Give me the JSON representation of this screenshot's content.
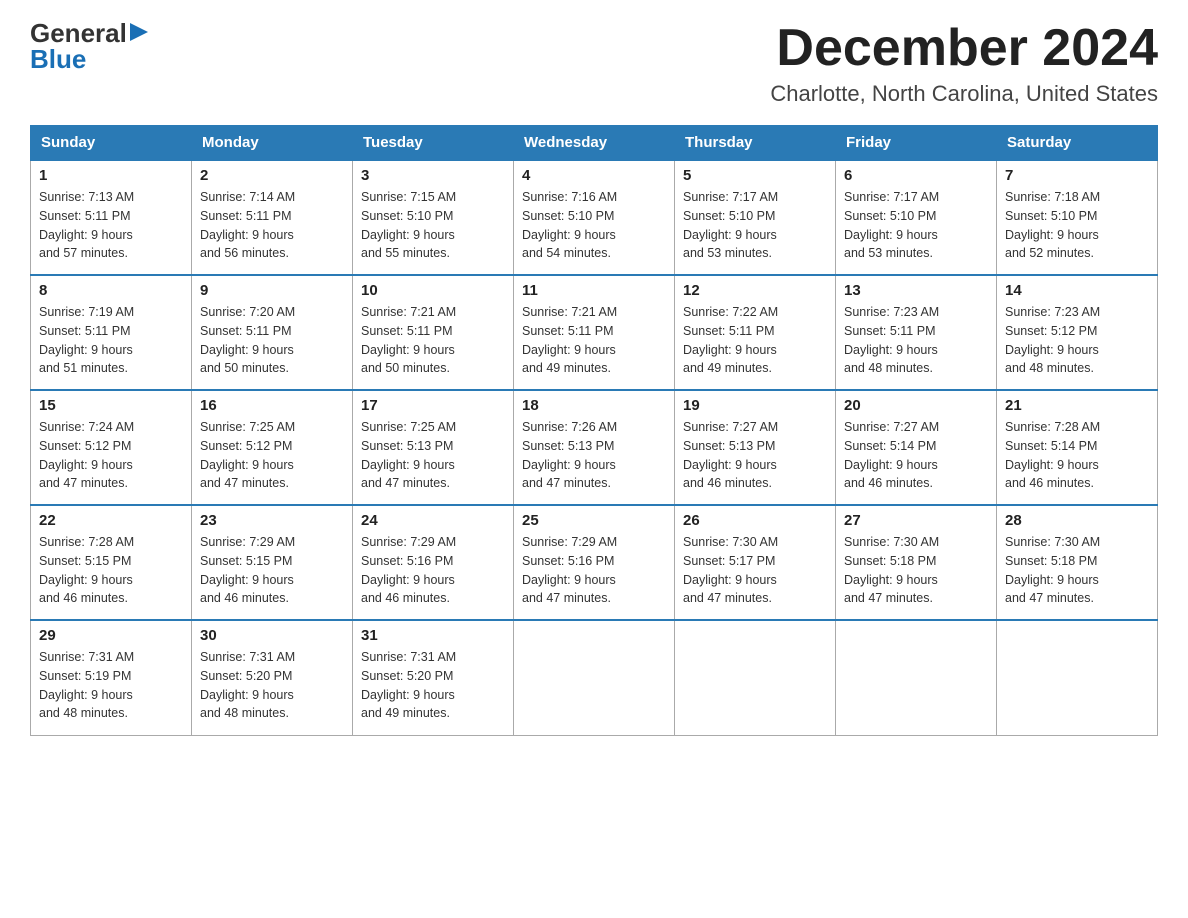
{
  "header": {
    "logo_general": "General",
    "logo_blue": "Blue",
    "month": "December 2024",
    "location": "Charlotte, North Carolina, United States"
  },
  "weekdays": [
    "Sunday",
    "Monday",
    "Tuesday",
    "Wednesday",
    "Thursday",
    "Friday",
    "Saturday"
  ],
  "weeks": [
    [
      {
        "day": "1",
        "sunrise": "7:13 AM",
        "sunset": "5:11 PM",
        "daylight": "9 hours and 57 minutes."
      },
      {
        "day": "2",
        "sunrise": "7:14 AM",
        "sunset": "5:11 PM",
        "daylight": "9 hours and 56 minutes."
      },
      {
        "day": "3",
        "sunrise": "7:15 AM",
        "sunset": "5:10 PM",
        "daylight": "9 hours and 55 minutes."
      },
      {
        "day": "4",
        "sunrise": "7:16 AM",
        "sunset": "5:10 PM",
        "daylight": "9 hours and 54 minutes."
      },
      {
        "day": "5",
        "sunrise": "7:17 AM",
        "sunset": "5:10 PM",
        "daylight": "9 hours and 53 minutes."
      },
      {
        "day": "6",
        "sunrise": "7:17 AM",
        "sunset": "5:10 PM",
        "daylight": "9 hours and 53 minutes."
      },
      {
        "day": "7",
        "sunrise": "7:18 AM",
        "sunset": "5:10 PM",
        "daylight": "9 hours and 52 minutes."
      }
    ],
    [
      {
        "day": "8",
        "sunrise": "7:19 AM",
        "sunset": "5:11 PM",
        "daylight": "9 hours and 51 minutes."
      },
      {
        "day": "9",
        "sunrise": "7:20 AM",
        "sunset": "5:11 PM",
        "daylight": "9 hours and 50 minutes."
      },
      {
        "day": "10",
        "sunrise": "7:21 AM",
        "sunset": "5:11 PM",
        "daylight": "9 hours and 50 minutes."
      },
      {
        "day": "11",
        "sunrise": "7:21 AM",
        "sunset": "5:11 PM",
        "daylight": "9 hours and 49 minutes."
      },
      {
        "day": "12",
        "sunrise": "7:22 AM",
        "sunset": "5:11 PM",
        "daylight": "9 hours and 49 minutes."
      },
      {
        "day": "13",
        "sunrise": "7:23 AM",
        "sunset": "5:11 PM",
        "daylight": "9 hours and 48 minutes."
      },
      {
        "day": "14",
        "sunrise": "7:23 AM",
        "sunset": "5:12 PM",
        "daylight": "9 hours and 48 minutes."
      }
    ],
    [
      {
        "day": "15",
        "sunrise": "7:24 AM",
        "sunset": "5:12 PM",
        "daylight": "9 hours and 47 minutes."
      },
      {
        "day": "16",
        "sunrise": "7:25 AM",
        "sunset": "5:12 PM",
        "daylight": "9 hours and 47 minutes."
      },
      {
        "day": "17",
        "sunrise": "7:25 AM",
        "sunset": "5:13 PM",
        "daylight": "9 hours and 47 minutes."
      },
      {
        "day": "18",
        "sunrise": "7:26 AM",
        "sunset": "5:13 PM",
        "daylight": "9 hours and 47 minutes."
      },
      {
        "day": "19",
        "sunrise": "7:27 AM",
        "sunset": "5:13 PM",
        "daylight": "9 hours and 46 minutes."
      },
      {
        "day": "20",
        "sunrise": "7:27 AM",
        "sunset": "5:14 PM",
        "daylight": "9 hours and 46 minutes."
      },
      {
        "day": "21",
        "sunrise": "7:28 AM",
        "sunset": "5:14 PM",
        "daylight": "9 hours and 46 minutes."
      }
    ],
    [
      {
        "day": "22",
        "sunrise": "7:28 AM",
        "sunset": "5:15 PM",
        "daylight": "9 hours and 46 minutes."
      },
      {
        "day": "23",
        "sunrise": "7:29 AM",
        "sunset": "5:15 PM",
        "daylight": "9 hours and 46 minutes."
      },
      {
        "day": "24",
        "sunrise": "7:29 AM",
        "sunset": "5:16 PM",
        "daylight": "9 hours and 46 minutes."
      },
      {
        "day": "25",
        "sunrise": "7:29 AM",
        "sunset": "5:16 PM",
        "daylight": "9 hours and 47 minutes."
      },
      {
        "day": "26",
        "sunrise": "7:30 AM",
        "sunset": "5:17 PM",
        "daylight": "9 hours and 47 minutes."
      },
      {
        "day": "27",
        "sunrise": "7:30 AM",
        "sunset": "5:18 PM",
        "daylight": "9 hours and 47 minutes."
      },
      {
        "day": "28",
        "sunrise": "7:30 AM",
        "sunset": "5:18 PM",
        "daylight": "9 hours and 47 minutes."
      }
    ],
    [
      {
        "day": "29",
        "sunrise": "7:31 AM",
        "sunset": "5:19 PM",
        "daylight": "9 hours and 48 minutes."
      },
      {
        "day": "30",
        "sunrise": "7:31 AM",
        "sunset": "5:20 PM",
        "daylight": "9 hours and 48 minutes."
      },
      {
        "day": "31",
        "sunrise": "7:31 AM",
        "sunset": "5:20 PM",
        "daylight": "9 hours and 49 minutes."
      },
      null,
      null,
      null,
      null
    ]
  ],
  "labels": {
    "sunrise": "Sunrise:",
    "sunset": "Sunset:",
    "daylight": "Daylight:"
  }
}
